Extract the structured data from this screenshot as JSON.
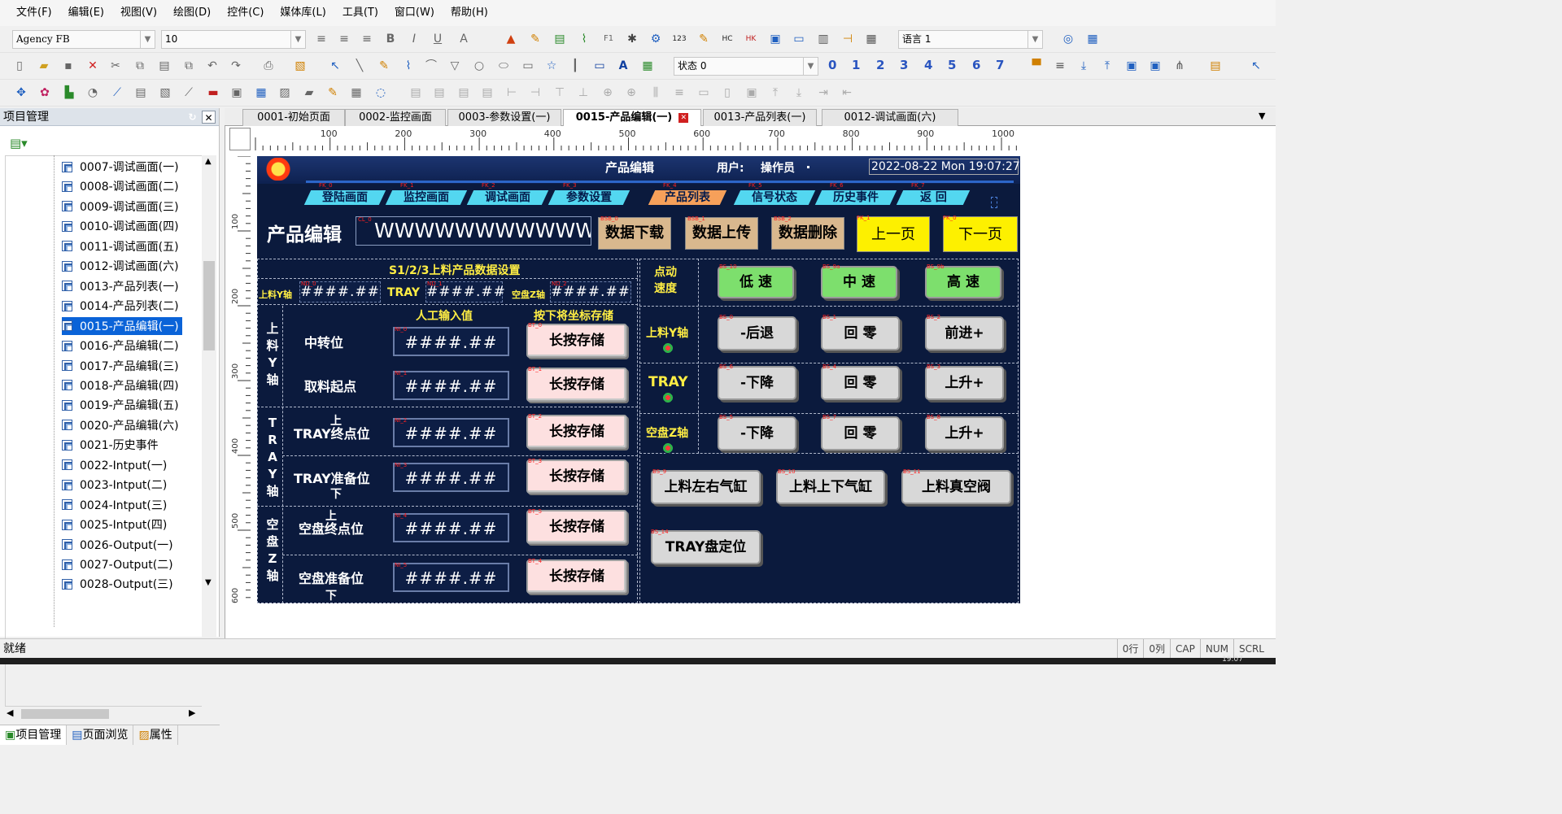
{
  "menu": [
    "文件(F)",
    "编辑(E)",
    "视图(V)",
    "绘图(D)",
    "控件(C)",
    "媒体库(L)",
    "工具(T)",
    "窗口(W)",
    "帮助(H)"
  ],
  "toolbar": {
    "font": "Agency FB",
    "font_size": "10",
    "language": "语言 1",
    "state": "状态 0",
    "state_numbers": [
      "0",
      "1",
      "2",
      "3",
      "4",
      "5",
      "6",
      "7"
    ],
    "f1": "F1",
    "n123": "123",
    "hc": "HC",
    "hk": "HK"
  },
  "panel": {
    "title": "项目管理",
    "tree_items": [
      "0007-调试画面(一)",
      "0008-调试画面(二)",
      "0009-调试画面(三)",
      "0010-调试画面(四)",
      "0011-调试画面(五)",
      "0012-调试画面(六)",
      "0013-产品列表(一)",
      "0014-产品列表(二)",
      "0015-产品编辑(一)",
      "0016-产品编辑(二)",
      "0017-产品编辑(三)",
      "0018-产品编辑(四)",
      "0019-产品编辑(五)",
      "0020-产品编辑(六)",
      "0021-历史事件",
      "0022-Intput(一)",
      "0023-Intput(二)",
      "0024-Intput(三)",
      "0025-Intput(四)",
      "0026-Output(一)",
      "0027-Output(二)",
      "0028-Output(三)"
    ],
    "selected_index": 8,
    "bottom_tabs": [
      "项目管理",
      "页面浏览",
      "属性"
    ]
  },
  "doc_tabs": [
    "0001-初始页面",
    "0002-监控画面",
    "0003-参数设置(一)",
    "0015-产品编辑(一)",
    "0013-产品列表(一)",
    "0012-调试画面(六)"
  ],
  "active_doc_tab": 3,
  "ruler": {
    "top": [
      "100",
      "200",
      "300",
      "400",
      "500",
      "600",
      "700",
      "800",
      "900",
      "1000"
    ],
    "left": [
      "100",
      "200",
      "300",
      "400",
      "500",
      "600"
    ]
  },
  "hmi": {
    "header_title": "产品编辑",
    "user_label": "用户:",
    "user_value": "操作员",
    "datetime": "2022-08-22 Mon 19:07:27",
    "nav": [
      "登陆画面",
      "监控画面",
      "调试画面",
      "参数设置",
      "产品列表",
      "信号状态",
      "历史事件",
      "返  回"
    ],
    "page_title": "产品编辑",
    "product_name": "WWWWWWWWWWWW",
    "top_buttons": [
      "数据下载",
      "数据上传",
      "数据删除"
    ],
    "prev": "上一页",
    "next": "下一页",
    "section_title": "S1/2/3上料产品数据设置",
    "axis_labels": [
      "上料Y轴",
      "TRAY",
      "空盘Z轴"
    ],
    "placeholder": "####.##",
    "col_manual": "人工输入值",
    "col_store": "按下将坐标存储",
    "group_labels": [
      "上",
      "料",
      "Y",
      "轴",
      "T",
      "R",
      "A",
      "Y",
      "轴",
      "空",
      "盘",
      "Z",
      "轴"
    ],
    "positions": [
      "中转位",
      "取料起点",
      "TRAY终点位",
      "TRAY准备位",
      "空盘终点位",
      "空盘准备位"
    ],
    "pos_marks": [
      "上",
      "下",
      "上",
      "下"
    ],
    "store": "长按存储",
    "speed_label": [
      "点动",
      "速度"
    ],
    "speeds": [
      "低  速",
      "中  速",
      "高  速"
    ],
    "jog_axes": [
      "上料Y轴",
      "TRAY",
      "空盘Z轴"
    ],
    "jog": [
      [
        "-后退",
        "回  零",
        "前进+"
      ],
      [
        "-下降",
        "回  零",
        "上升+"
      ],
      [
        "-下降",
        "回  零",
        "上升+"
      ]
    ],
    "cyl": [
      "上料左右气缸",
      "上料上下气缸",
      "上料真空阀"
    ],
    "tray_pos": "TRAY盘定位",
    "tags": {
      "nav": [
        "FK_0",
        "FK_1",
        "FK_2",
        "FK_3",
        "FK_4",
        "FK_5",
        "FK_6",
        "FK_7"
      ],
      "cl": "CL_0",
      "btn": [
        "BSB_0",
        "BSB_1",
        "BSB_2"
      ],
      "fk": [
        "FK_1",
        "FK_0"
      ],
      "nd": [
        "ND_0",
        "ND_1",
        "ND_2"
      ],
      "ni": [
        "NI_0",
        "NI_1",
        "NI_2",
        "NI_3",
        "NI_4",
        "NI_5"
      ],
      "bt": [
        "BT_0",
        "BT_1",
        "BT_2",
        "BT_3",
        "BT_5",
        "BT_4"
      ],
      "spd": [
        "BS_10",
        "BS_9a",
        "BS_9b"
      ],
      "jog": [
        "BS_0",
        "BS_1",
        "BS_2",
        "BS_6",
        "BS_4",
        "BS_3",
        "BS_5",
        "BS_7",
        "BS_8"
      ],
      "cyl": [
        "BS_9",
        "BS_10",
        "BS_11"
      ],
      "tp": "BS_14"
    }
  },
  "status": {
    "left": "就绪",
    "right": [
      "0行",
      "0列",
      "CAP",
      "NUM",
      "SCRL"
    ]
  },
  "taskbar_time": "19:07"
}
